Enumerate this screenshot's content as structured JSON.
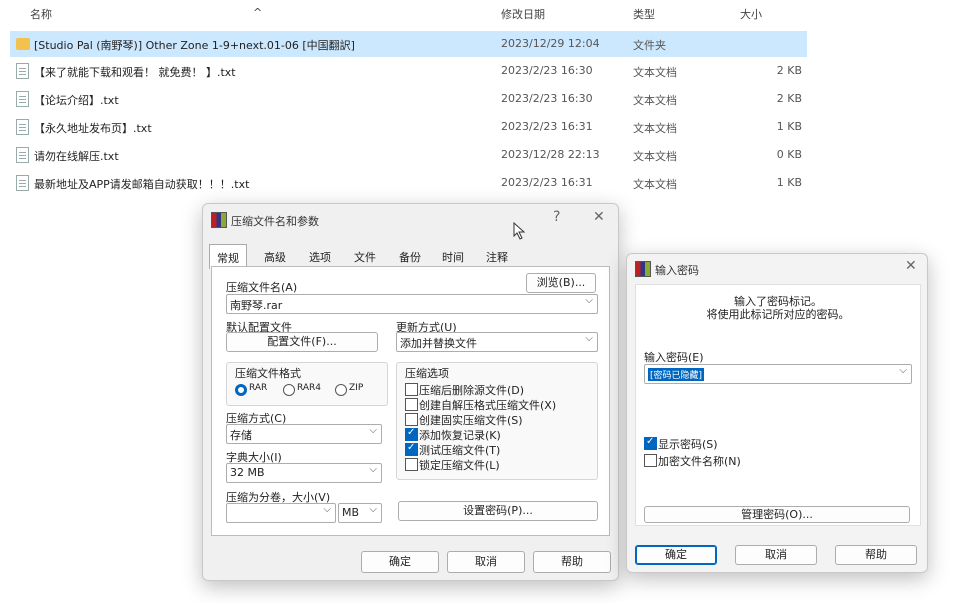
{
  "explorer": {
    "columns": {
      "name": "名称",
      "date": "修改日期",
      "type": "类型",
      "size": "大小"
    },
    "rows": [
      {
        "name": "[Studio Pal (南野琴)] Other Zone 1-9+next.01-06 [中国翻訳]",
        "date": "2023/12/29 12:04",
        "type": "文件夹",
        "size": "",
        "kind": "folder",
        "selected": true
      },
      {
        "name": "【来了就能下载和观看！ 就免费！ 】.txt",
        "date": "2023/2/23 16:30",
        "type": "文本文档",
        "size": "2 KB",
        "kind": "file"
      },
      {
        "name": "【论坛介绍】.txt",
        "date": "2023/2/23 16:30",
        "type": "文本文档",
        "size": "2 KB",
        "kind": "file"
      },
      {
        "name": "【永久地址发布页】.txt",
        "date": "2023/2/23 16:31",
        "type": "文本文档",
        "size": "1 KB",
        "kind": "file"
      },
      {
        "name": "请勿在线解压.txt",
        "date": "2023/12/28 22:13",
        "type": "文本文档",
        "size": "0 KB",
        "kind": "file"
      },
      {
        "name": "最新地址及APP请发邮箱自动获取！！！.txt",
        "date": "2023/2/23 16:31",
        "type": "文本文档",
        "size": "1 KB",
        "kind": "file"
      }
    ]
  },
  "archive_dialog": {
    "title": "压缩文件名和参数",
    "help_btn": "?",
    "close_btn": "✕",
    "tabs": [
      "常规",
      "高级",
      "选项",
      "文件",
      "备份",
      "时间",
      "注释"
    ],
    "archive_name_label": "压缩文件名(A)",
    "browse_btn": "浏览(B)...",
    "archive_name_value": "南野琴.rar",
    "default_profile_label": "默认配置文件",
    "profile_btn": "配置文件(F)...",
    "update_mode_label": "更新方式(U)",
    "update_mode_value": "添加并替换文件",
    "format_group_label": "压缩文件格式",
    "formats": [
      "RAR",
      "RAR4",
      "ZIP"
    ],
    "options_group_label": "压缩选项",
    "options": [
      {
        "label": "压缩后删除源文件(D)",
        "checked": false
      },
      {
        "label": "创建自解压格式压缩文件(X)",
        "checked": false
      },
      {
        "label": "创建固实压缩文件(S)",
        "checked": false
      },
      {
        "label": "添加恢复记录(K)",
        "checked": true
      },
      {
        "label": "测试压缩文件(T)",
        "checked": true
      },
      {
        "label": "锁定压缩文件(L)",
        "checked": false
      }
    ],
    "method_label": "压缩方式(C)",
    "method_value": "存储",
    "dict_label": "字典大小(I)",
    "dict_value": "32 MB",
    "split_label": "压缩为分卷，大小(V)",
    "split_value": "",
    "split_unit": "MB",
    "set_password_btn": "设置密码(P)...",
    "ok_btn": "确定",
    "cancel_btn": "取消",
    "help_bottom_btn": "帮助"
  },
  "password_dialog": {
    "title": "输入密码",
    "close_btn": "✕",
    "info_line1": "输入了密码标记。",
    "info_line2": "将使用此标记所对应的密码。",
    "password_label": "输入密码(E)",
    "password_value": "[密码已隐藏]",
    "show_password": {
      "label": "显示密码(S)",
      "checked": true
    },
    "encrypt_names": {
      "label": "加密文件名称(N)",
      "checked": false
    },
    "manage_btn": "管理密码(O)...",
    "ok_btn": "确定",
    "cancel_btn": "取消",
    "help_btn": "帮助"
  }
}
